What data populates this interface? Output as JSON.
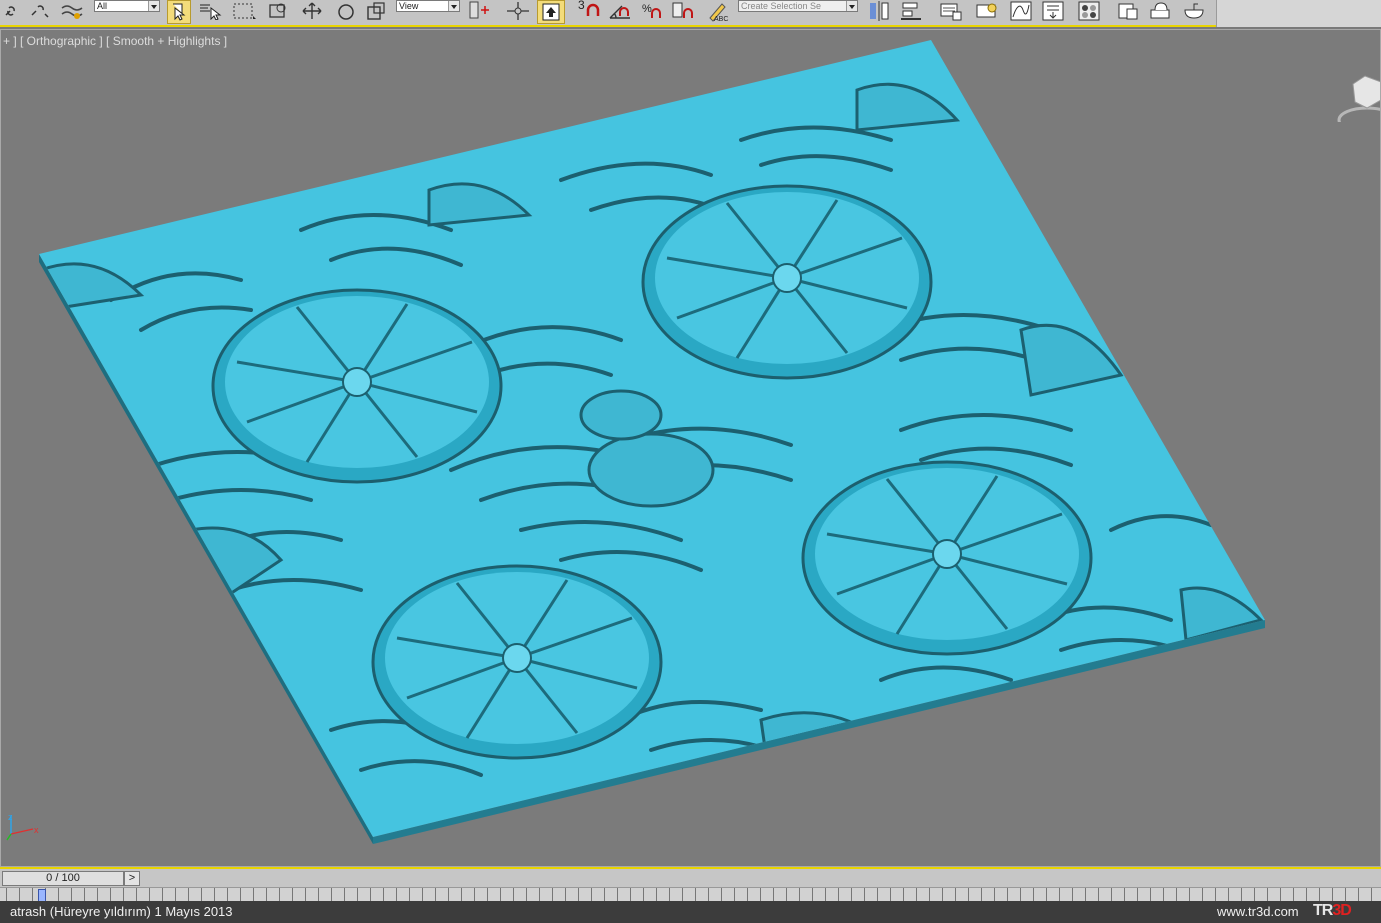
{
  "toolbar": {
    "filter_combo": "All",
    "refcoord_combo": "View",
    "selection_set_placeholder": "Create Selection Se",
    "snap_angle_label": "3",
    "icons": [
      "link-icon",
      "unlink-icon",
      "bind-spacewarp-icon",
      "select-object-icon",
      "select-by-name-icon",
      "rect-selection-icon",
      "window-crossing-icon",
      "move-icon",
      "rotate-icon",
      "scale-icon",
      "pivot-icon",
      "select-manipulate-icon",
      "keyboard-shortcut-icon",
      "snap-toggle-icon",
      "angle-snap-icon",
      "percent-snap-icon",
      "spinner-snap-icon",
      "edit-named-sets-icon",
      "mirror-icon",
      "align-icon",
      "layer-manager-icon",
      "graphite-ribbon-icon",
      "curve-editor-icon",
      "schematic-view-icon",
      "material-editor-icon",
      "render-setup-icon",
      "rendered-frame-icon",
      "render-icon"
    ]
  },
  "viewport": {
    "label": "+ ] [ Orthographic ] [ Smooth + Highlights ]",
    "object_color": "#45c4e0",
    "background": "#7b7b7b"
  },
  "timeline": {
    "slider_label": "0 / 100",
    "next_label": ">"
  },
  "status": {
    "caption": "atrash (Hüreyre yıldırım)  1 Mayıs 2013",
    "site": "www.tr3d.com",
    "logo_left": "TR",
    "logo_right": "3D"
  },
  "colors": {
    "accent_yellow": "#e8d400",
    "toolbar_bg": "#c4c4c4",
    "statusbar_bg": "#3c3c3c"
  }
}
